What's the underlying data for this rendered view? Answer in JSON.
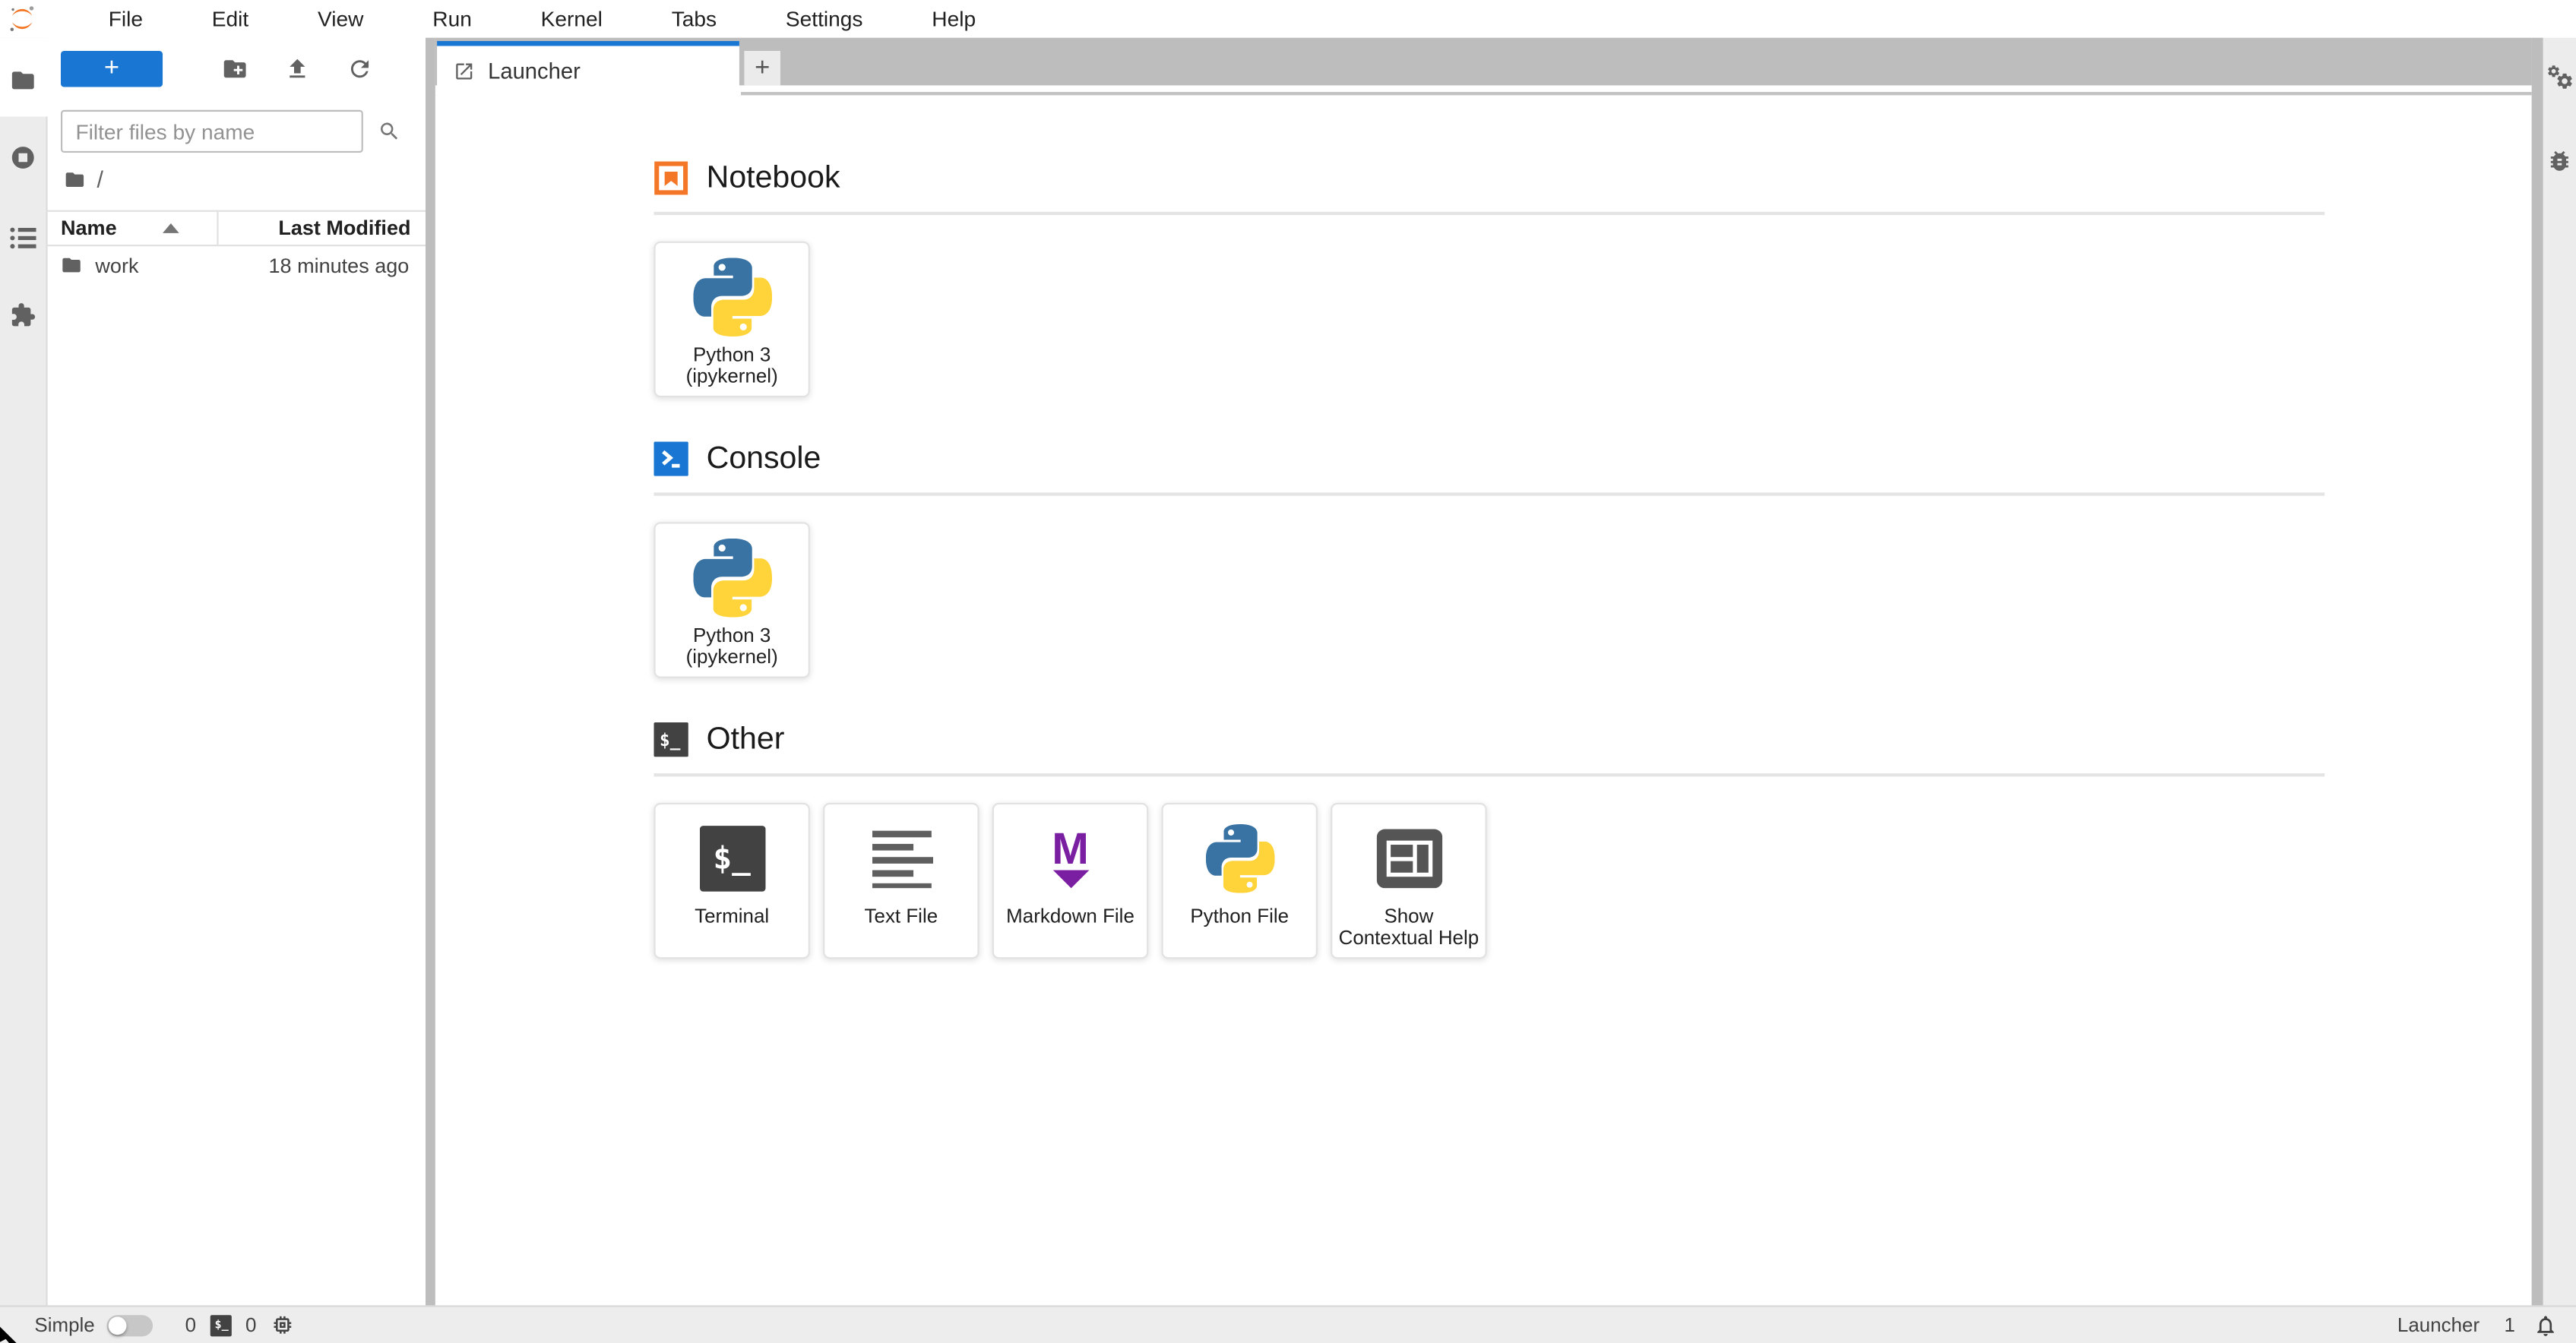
{
  "menu": {
    "items": [
      "File",
      "Edit",
      "View",
      "Run",
      "Kernel",
      "Tabs",
      "Settings",
      "Help"
    ]
  },
  "activity_bar": {
    "left_tabs": [
      "file-browser",
      "running-sessions",
      "table-of-contents",
      "extensions"
    ],
    "right_tabs": [
      "property-inspector",
      "debugger"
    ]
  },
  "file_browser": {
    "new_launcher_label": "+",
    "filter_placeholder": "Filter files by name",
    "breadcrumb_root": "/",
    "columns": {
      "name": "Name",
      "last_modified": "Last Modified"
    },
    "rows": [
      {
        "name": "work",
        "last_modified": "18 minutes ago",
        "type": "folder"
      }
    ]
  },
  "dock": {
    "tabs": [
      {
        "label": "Launcher",
        "active": true
      }
    ],
    "add_tab_label": "+"
  },
  "launcher": {
    "sections": [
      {
        "title": "Notebook",
        "cards": [
          {
            "line1": "Python 3",
            "line2": "(ipykernel)",
            "icon": "python-logo"
          }
        ]
      },
      {
        "title": "Console",
        "cards": [
          {
            "line1": "Python 3",
            "line2": "(ipykernel)",
            "icon": "python-logo"
          }
        ]
      },
      {
        "title": "Other",
        "cards": [
          {
            "line1": "Terminal",
            "line2": "",
            "icon": "terminal"
          },
          {
            "line1": "Text File",
            "line2": "",
            "icon": "text-file"
          },
          {
            "line1": "Markdown File",
            "line2": "",
            "icon": "markdown-file"
          },
          {
            "line1": "Python File",
            "line2": "",
            "icon": "python-logo"
          },
          {
            "line1": "Show",
            "line2": "Contextual Help",
            "icon": "contextual-help"
          }
        ]
      }
    ]
  },
  "status_bar": {
    "mode_label": "Simple",
    "terminal_count": "0",
    "kernel_count": "0",
    "current_activity": "Launcher",
    "notification_count": "1"
  },
  "glyphs": {
    "terminal_prompt": "$_",
    "markdown_m": "M"
  },
  "colors": {
    "brand_blue": "#1976d2",
    "jupyter_orange": "#F37726",
    "markdown_purple": "#7B1FA2",
    "terminal_dark": "#424242",
    "python_blue": "#3873A3",
    "python_yellow": "#FFD43B",
    "tabbar_gray": "#bdbdbd",
    "strip_gray": "#ececec"
  }
}
